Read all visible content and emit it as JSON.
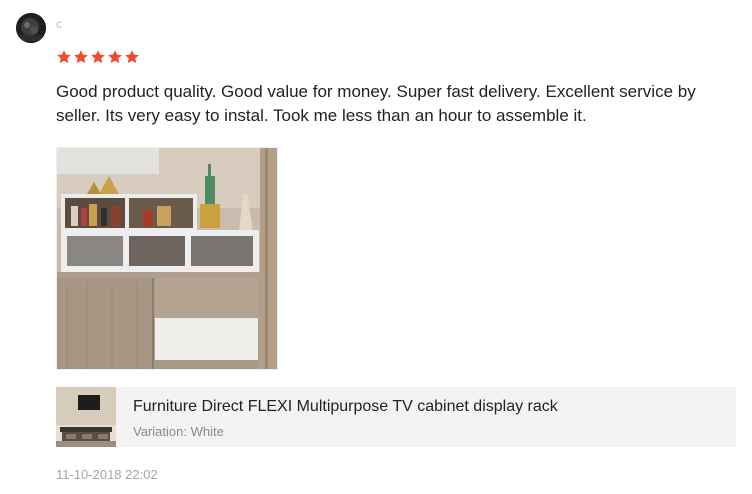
{
  "reviewer": {
    "name": "c"
  },
  "rating": {
    "stars": 5,
    "max": 5,
    "color": "#ee4d2d"
  },
  "review": {
    "text": "Good product quality. Good value for money. Super fast delivery. Excellent service by seller. Its very easy to instal. Took me less than an hour to assemble it."
  },
  "product": {
    "name": "Furniture Direct FLEXI Multipurpose TV cabinet display rack",
    "variation": "Variation: White"
  },
  "timestamp": "11-10-2018 22:02"
}
